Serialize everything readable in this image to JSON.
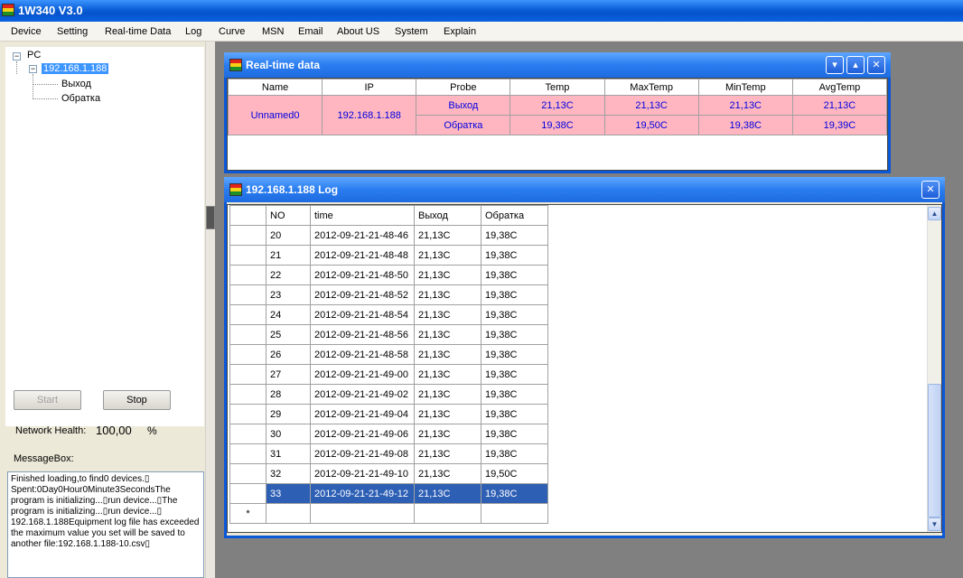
{
  "app": {
    "title": "1W340 V3.0"
  },
  "menu": [
    "Device",
    "Setting",
    "Real-time Data",
    "Log",
    "Curve",
    "MSN",
    "Email",
    "About US",
    "System",
    "Explain"
  ],
  "tree": {
    "root": "PC",
    "device": "192.168.1.188",
    "probes": [
      "Выход",
      "Обратка"
    ]
  },
  "controls": {
    "start_label": "Start",
    "stop_label": "Stop",
    "health_label": "Network Health:",
    "health_value": "100,00",
    "health_unit": "%",
    "msgbox_label": "MessageBox:"
  },
  "messages": "Finished loading,to find0 devices.▯ Spent:0Day0Hour0Minute3SecondsThe program is initializing...▯run device...▯The program is initializing...▯run device...▯ 192.168.1.188Equipment log file has exceeded the maximum value you set will be saved to another file:192.168.1.188-10.csv▯",
  "realtime": {
    "title": "Real-time data",
    "headers": [
      "Name",
      "IP",
      "Probe",
      "Temp",
      "MaxTemp",
      "MinTemp",
      "AvgTemp"
    ],
    "name": "Unnamed0",
    "ip": "192.168.1.188",
    "rows": [
      {
        "probe": "Выход",
        "temp": "21,13C",
        "max": "21,13C",
        "min": "21,13C",
        "avg": "21,13C"
      },
      {
        "probe": "Обратка",
        "temp": "19,38C",
        "max": "19,50C",
        "min": "19,38C",
        "avg": "19,39C"
      }
    ]
  },
  "log": {
    "title": "192.168.1.188 Log",
    "headers": [
      "NO",
      "time",
      "Выход",
      "Обратка"
    ],
    "rows": [
      [
        "20",
        "2012-09-21-21-48-46",
        "21,13C",
        "19,38C"
      ],
      [
        "21",
        "2012-09-21-21-48-48",
        "21,13C",
        "19,38C"
      ],
      [
        "22",
        "2012-09-21-21-48-50",
        "21,13C",
        "19,38C"
      ],
      [
        "23",
        "2012-09-21-21-48-52",
        "21,13C",
        "19,38C"
      ],
      [
        "24",
        "2012-09-21-21-48-54",
        "21,13C",
        "19,38C"
      ],
      [
        "25",
        "2012-09-21-21-48-56",
        "21,13C",
        "19,38C"
      ],
      [
        "26",
        "2012-09-21-21-48-58",
        "21,13C",
        "19,38C"
      ],
      [
        "27",
        "2012-09-21-21-49-00",
        "21,13C",
        "19,38C"
      ],
      [
        "28",
        "2012-09-21-21-49-02",
        "21,13C",
        "19,38C"
      ],
      [
        "29",
        "2012-09-21-21-49-04",
        "21,13C",
        "19,38C"
      ],
      [
        "30",
        "2012-09-21-21-49-06",
        "21,13C",
        "19,38C"
      ],
      [
        "31",
        "2012-09-21-21-49-08",
        "21,13C",
        "19,38C"
      ],
      [
        "32",
        "2012-09-21-21-49-10",
        "21,13C",
        "19,50C"
      ],
      [
        "33",
        "2012-09-21-21-49-12",
        "21,13C",
        "19,38C"
      ]
    ],
    "new_row_marker": "*"
  }
}
